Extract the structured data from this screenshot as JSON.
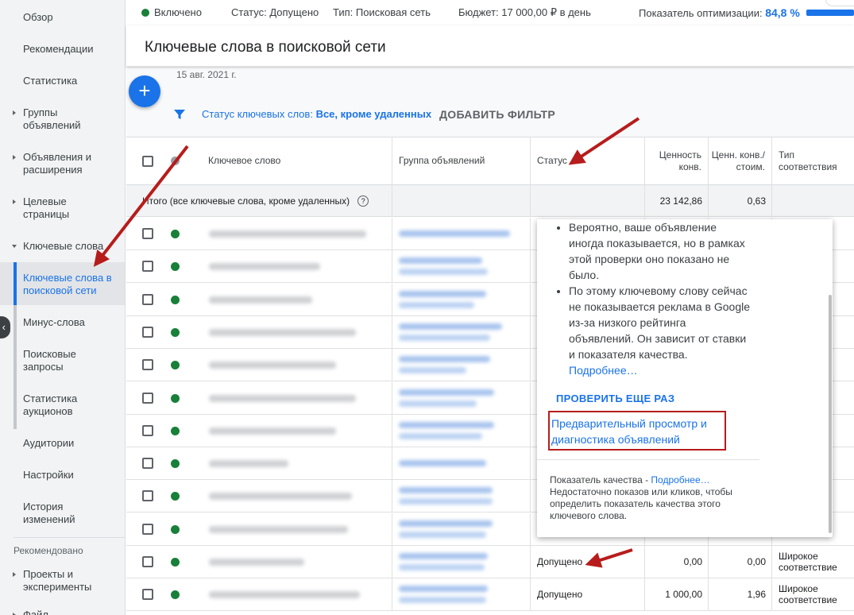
{
  "sidebar": {
    "items": [
      {
        "label": "Обзор"
      },
      {
        "label": "Рекомендации"
      },
      {
        "label": "Статистика"
      },
      {
        "label": "Группы объявлений"
      },
      {
        "label": "Объявления и расширения"
      },
      {
        "label": "Целевые страницы"
      },
      {
        "label": "Ключевые слова"
      },
      {
        "label": "Ключевые слова в поисковой сети"
      },
      {
        "label": "Минус-слова"
      },
      {
        "label": "Поисковые запросы"
      },
      {
        "label": "Статистика аукционов"
      },
      {
        "label": "Аудитории"
      },
      {
        "label": "Настройки"
      },
      {
        "label": "История изменений"
      },
      {
        "label": "Проекты и эксперименты"
      },
      {
        "label": "Файл"
      }
    ],
    "section_recommended": "Рекомендовано"
  },
  "topbar": {
    "state": "Включено",
    "status": "Статус: Допущено",
    "type": "Тип: Поисковая сеть",
    "budget": "Бюджет: 17 000,00 ₽ в день",
    "opt_label": "Показатель оптимизации:",
    "opt_value": "84,8 %"
  },
  "page": {
    "title": "Ключевые слова в поисковой сети",
    "date": "15 авг. 2021 г.",
    "fab": "+"
  },
  "filter": {
    "label": "Статус ключевых слов:",
    "value": "Все, кроме удаленных",
    "add": "ДОБАВИТЬ ФИЛЬТР"
  },
  "table": {
    "headers": {
      "keyword": "Ключевое слово",
      "adgroup": "Группа объявлений",
      "status": "Статус",
      "conv_value": "Ценность конв.",
      "conv_value_cost": "Ценн. конв./ стоим.",
      "match_type": "Тип соответствия"
    },
    "total": {
      "label": "Итого (все ключевые слова, кроме удаленных)",
      "help": "?",
      "conv_value": "23 142,86",
      "conv_value_cost": "0,63"
    },
    "rows": [
      {
        "match": ""
      },
      {
        "match": ""
      },
      {
        "match": ""
      },
      {
        "match": ""
      },
      {
        "match": ""
      },
      {
        "match": ""
      },
      {
        "match": ""
      },
      {
        "match": ""
      },
      {
        "match": ""
      },
      {
        "match": ""
      },
      {
        "status": "Допущено",
        "conv_value": "0,00",
        "ratio": "0,00",
        "match": "Широкое соответствие"
      },
      {
        "status": "Допущено",
        "conv_value": "1 000,00",
        "ratio": "1,96",
        "match": "Широкое соответствие"
      }
    ],
    "match_partial": "Ш",
    "match_partial_cut": "Ш"
  },
  "popup": {
    "bullet1": "Вероятно, ваше объявление иногда показывается, но в рамках этой проверки оно показано не было.",
    "bullet2": "По этому ключевому слову сейчас не показывается реклама в Google из-за низкого рейтинга объявлений. Он зависит от ставки и показателя качества.",
    "more": "Подробнее…",
    "recheck": "ПРОВЕРИТЬ ЕЩЕ РАЗ",
    "preview": "Предварительный просмотр и диагностика объявлений",
    "qs_label": "Показатель качества -",
    "qs_more": "Подробнее…",
    "qs_text": "Недостаточно показов или кликов, чтобы определить показатель качества этого ключевого слова."
  },
  "colors": {
    "accent": "#1a73e8",
    "enabled": "#188038",
    "arrow": "#b71c1c"
  }
}
